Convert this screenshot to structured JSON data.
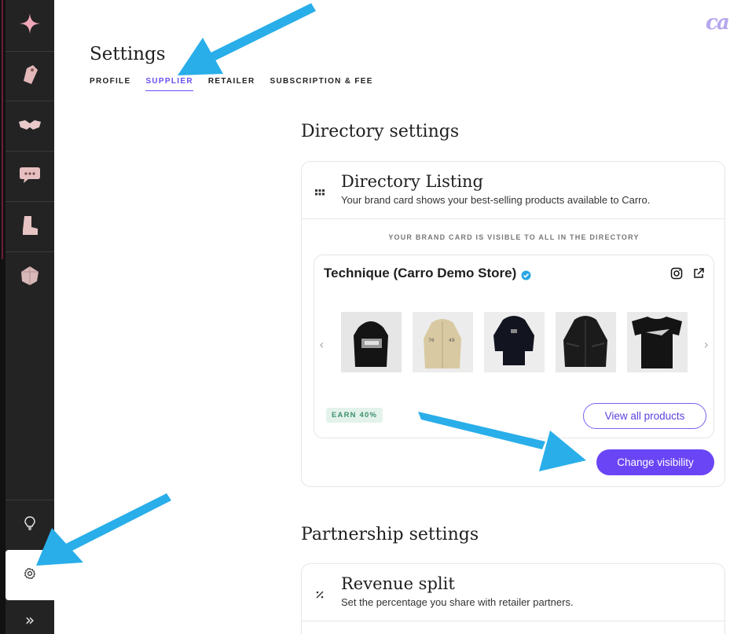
{
  "app": {
    "logo_text": "ca"
  },
  "sidebar": {
    "items": [
      {
        "name": "sparkle-logo-icon"
      },
      {
        "name": "price-tag-icon"
      },
      {
        "name": "handshake-icon"
      },
      {
        "name": "chat-bubble-icon"
      },
      {
        "name": "boot-icon"
      },
      {
        "name": "gem-icon"
      }
    ],
    "bottom": [
      {
        "name": "lightbulb-icon"
      },
      {
        "name": "gear-icon"
      }
    ],
    "expand_glyph": "»"
  },
  "header": {
    "title": "Settings",
    "tabs": [
      {
        "label": "PROFILE",
        "active": false
      },
      {
        "label": "SUPPLIER",
        "active": true
      },
      {
        "label": "RETAILER",
        "active": false
      },
      {
        "label": "SUBSCRIPTION & FEE",
        "active": false
      }
    ]
  },
  "directory": {
    "section_title": "Directory settings",
    "card_title": "Directory Listing",
    "card_subtitle": "Your brand card shows your best-selling products available to Carro.",
    "visibility_note": "YOUR BRAND CARD IS VISIBLE TO ALL IN THE DIRECTORY",
    "brand_name": "Technique (Carro Demo Store)",
    "products": [
      {
        "name": "black-hoodie-graphic"
      },
      {
        "name": "tan-anorak"
      },
      {
        "name": "black-cropped-hoodie"
      },
      {
        "name": "black-windbreaker"
      },
      {
        "name": "black-tshirt-graphic"
      }
    ],
    "earn_badge": "EARN 40%",
    "view_all_label": "View all products",
    "change_visibility_label": "Change visibility"
  },
  "partnership": {
    "section_title": "Partnership settings",
    "card_title": "Revenue split",
    "card_subtitle": "Set the percentage you share with retailer partners."
  },
  "colors": {
    "accent": "#6a45f5",
    "sidebar_bg": "#232323",
    "arrow": "#29aee9"
  }
}
